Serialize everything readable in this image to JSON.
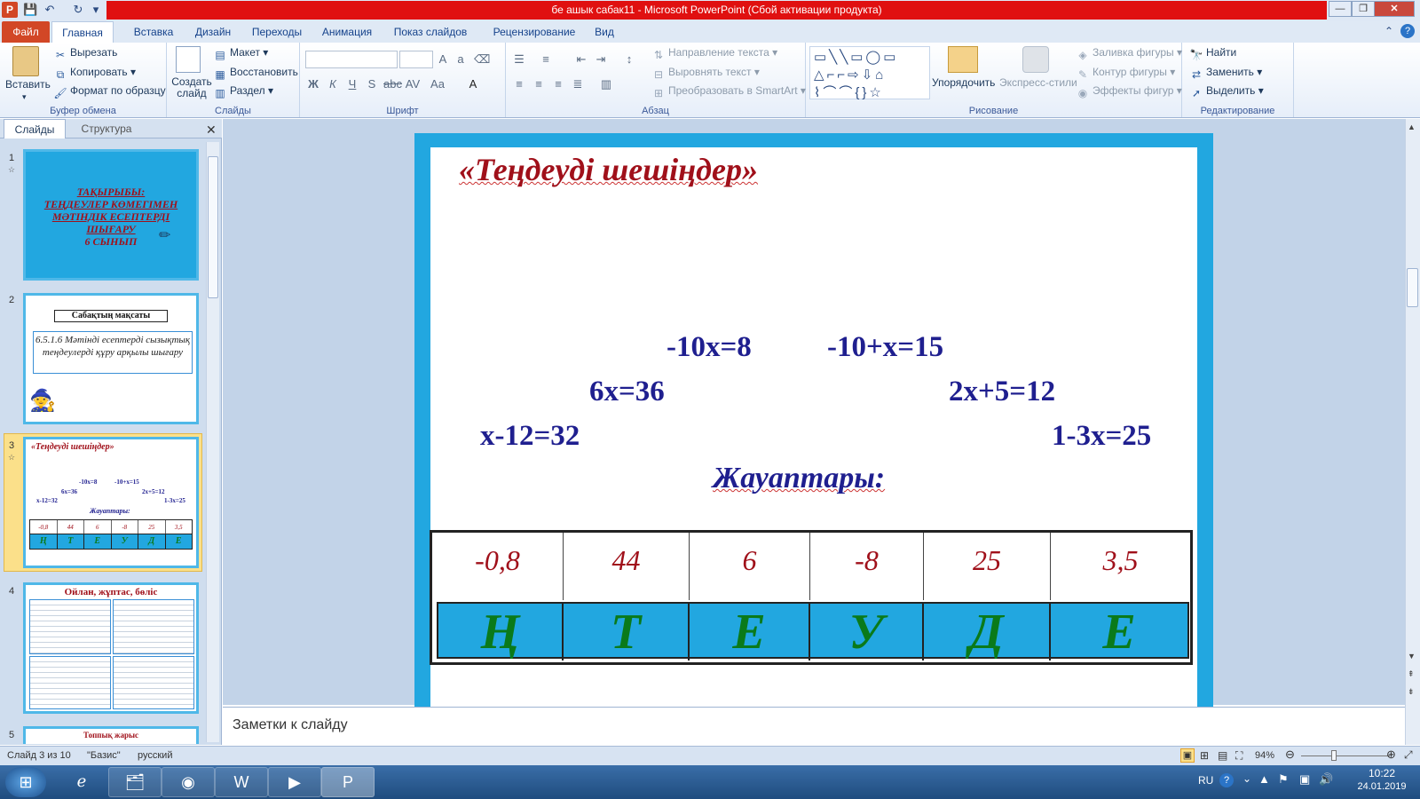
{
  "window": {
    "title": "бе ашык сабак11  -  Microsoft PowerPoint (Сбой активации продукта)"
  },
  "tabs": [
    "Файл",
    "Главная",
    "Вставка",
    "Дизайн",
    "Переходы",
    "Анимация",
    "Показ слайдов",
    "Рецензирование",
    "Вид"
  ],
  "ribbon": {
    "clipboard": {
      "paste": "Вставить",
      "cut": "Вырезать",
      "copy": "Копировать",
      "format": "Формат по образцу",
      "label": "Буфер обмена"
    },
    "slides": {
      "new_slide": "Создать слайд",
      "layout": "Макет",
      "reset": "Восстановить",
      "section": "Раздел",
      "label": "Слайды"
    },
    "font": {
      "label": "Шрифт"
    },
    "paragraph": {
      "text_direction": "Направление текста",
      "align_text": "Выровнять текст",
      "smartart": "Преобразовать в SmartArt",
      "label": "Абзац"
    },
    "drawing": {
      "arrange": "Упорядочить",
      "quick_styles": "Экспресс-стили",
      "fill": "Заливка фигуры",
      "outline": "Контур фигуры",
      "effects": "Эффекты фигур",
      "label": "Рисование"
    },
    "editing": {
      "find": "Найти",
      "replace": "Заменить",
      "select": "Выделить",
      "label": "Редактирование"
    }
  },
  "left_pane": {
    "tab_slides": "Слайды",
    "tab_outline": "Структура",
    "thumbs": [
      {
        "num": "1",
        "lines": [
          "ТАҚЫРЫБЫ:",
          "ТЕҢДЕУЛЕР КӨМЕГІМЕН",
          "МӘТІНДІК ЕСЕПТЕРДІ",
          "ШЫҒАРУ",
          "6 СЫНЫП"
        ]
      },
      {
        "num": "2",
        "heading": "Сабақтың мақсаты",
        "body": "6.5.1.6  Мәтінді есептерді сызықтық теңдеулерді құру арқылы шығару"
      },
      {
        "num": "3",
        "title": "«Теңдеуді шешіңдер»",
        "answers": "Жауаптары:"
      },
      {
        "num": "4",
        "title": "Ойлан, жұптас, бөліс"
      },
      {
        "num": "5",
        "title": "Топпық жарыс"
      }
    ]
  },
  "slide": {
    "title": "«Теңдеуді шешіңдер»",
    "equations": [
      "-10x=8",
      "-10+x=15",
      "6x=36",
      "2x+5=12",
      "x-12=32",
      "1-3x=25"
    ],
    "answers_heading": "Жауаптары:",
    "answers": [
      "-0,8",
      "44",
      "6",
      "-8",
      "25",
      "3,5"
    ],
    "letters": [
      "Ң",
      "Т",
      "Е",
      "У",
      "Д",
      "Е"
    ]
  },
  "notes_placeholder": "Заметки к слайду",
  "status": {
    "slide_of": "Слайд 3 из 10",
    "theme": "\"Базис\"",
    "language": "русский",
    "zoom": "94%"
  },
  "taskbar": {
    "lang": "RU",
    "time": "10:22",
    "date": "24.01.2019"
  }
}
